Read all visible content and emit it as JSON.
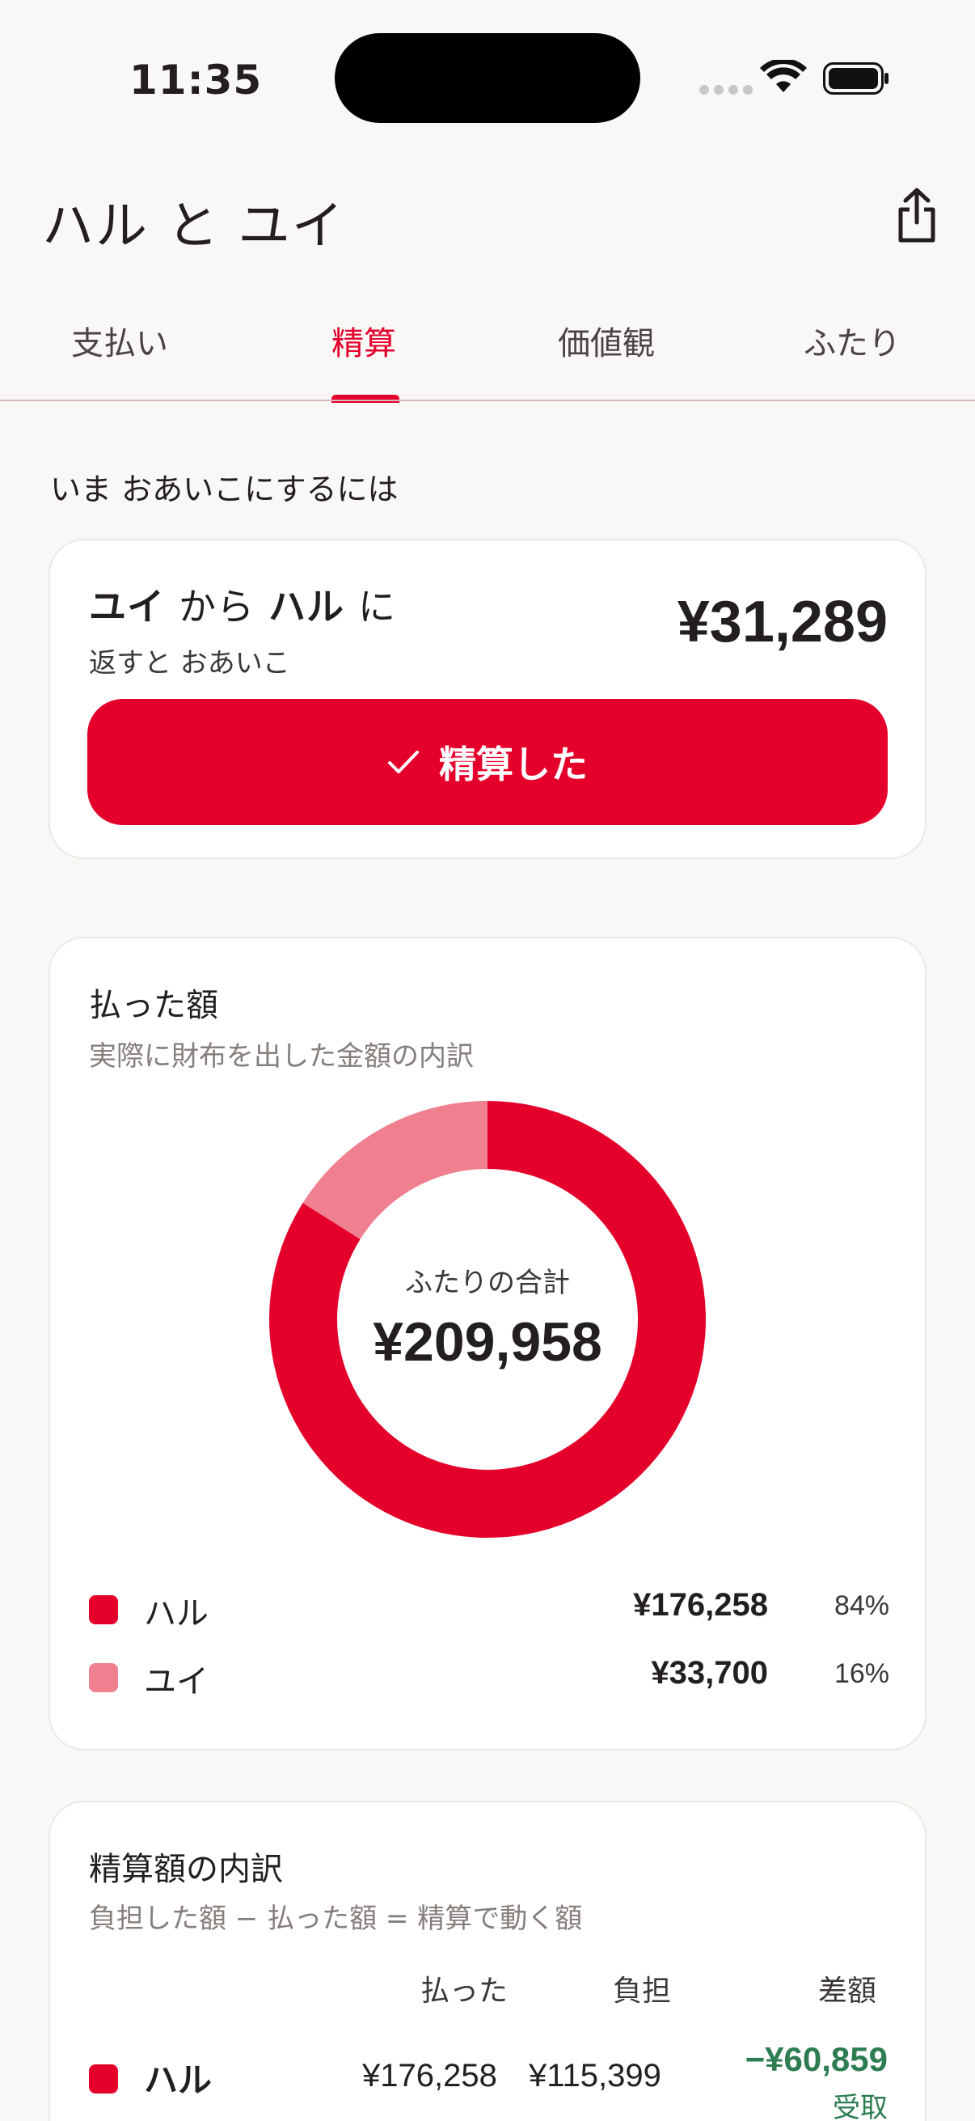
{
  "status_bar": {
    "time": "11:35"
  },
  "header": {
    "title": "ハル と ユイ"
  },
  "tabs": [
    {
      "label": "支払い"
    },
    {
      "label": "精算"
    },
    {
      "label": "価値観"
    },
    {
      "label": "ふたり"
    }
  ],
  "active_tab": "精算",
  "section_heading": "いま おあいこにするには",
  "settle": {
    "from": "ユイ",
    "from_particle": "から",
    "to": "ハル",
    "to_particle": "に",
    "sub": "返すと おあいこ",
    "amount": "¥31,289",
    "button_label": "精算した"
  },
  "paid": {
    "title": "払った額",
    "subtitle": "実際に財布を出した金額の内訳",
    "total_label": "ふたりの合計",
    "total_value": "¥209,958",
    "legend": [
      {
        "name": "ハル",
        "amount": "¥176,258",
        "percent": "84%",
        "color": "#e4002b"
      },
      {
        "name": "ユイ",
        "amount": "¥33,700",
        "percent": "16%",
        "color": "#f08090"
      }
    ]
  },
  "chart_data": {
    "type": "pie",
    "categories": [
      "ハル",
      "ユイ"
    ],
    "values": [
      176258,
      33700
    ],
    "colors": [
      "#e4002b",
      "#f08090"
    ]
  },
  "breakdown": {
    "title": "精算額の内訳",
    "subtitle": "負担した額 − 払った額 = 精算で動く額",
    "columns": [
      "払った",
      "負担",
      "差額"
    ],
    "rows": [
      {
        "name": "ハル",
        "paid": "¥176,258",
        "burden": "¥115,399",
        "diff": "−¥60,859",
        "diff_label": "受取"
      }
    ]
  },
  "colors": {
    "accent": "#e4002b",
    "accent_light": "#f08090",
    "positive": "#2e7d52"
  }
}
